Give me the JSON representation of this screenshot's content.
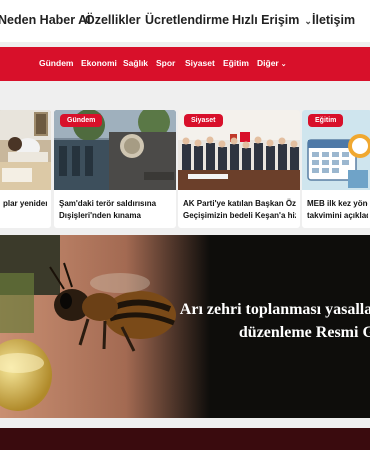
{
  "topnav": {
    "items": [
      {
        "label": "Neden Haber AI"
      },
      {
        "label": "Özellikler"
      },
      {
        "label": "Ücretlendirme"
      },
      {
        "label": "Hızlı Erişim",
        "chevron": "chevron-down-icon"
      },
      {
        "label": "İletişim"
      }
    ]
  },
  "categories": {
    "items": [
      {
        "label": "Gündem"
      },
      {
        "label": "Ekonomi"
      },
      {
        "label": "Sağlık"
      },
      {
        "label": "Spor"
      },
      {
        "label": "Siyaset"
      },
      {
        "label": "Eğitim"
      },
      {
        "label": "Diğer",
        "chevron": "chevron-down-icon"
      }
    ]
  },
  "cards": [
    {
      "badge": "",
      "title": "plar yeniden iz"
    },
    {
      "badge": "Gündem",
      "title_lines": [
        "Şam'daki terör saldırısına",
        "Dışişleri'nden kınama"
      ]
    },
    {
      "badge": "Siyaset",
      "title_lines": [
        "AK Parti'ye katılan Başkan Özcan:",
        "Geçişimizin bedeli Keşan'a hizmet..."
      ]
    },
    {
      "badge": "Eğitim",
      "title_lines": [
        "MEB ilk kez yönetici g",
        "takvimini açıkladı..."
      ]
    }
  ],
  "hero": {
    "headline_lines": [
      "Arı zehri toplanması yasallaştı! İlk kez y",
      "düzenleme Resmi Gaze"
    ]
  },
  "colors": {
    "brand": "#d8102a",
    "footer": "#3a0b0e"
  }
}
